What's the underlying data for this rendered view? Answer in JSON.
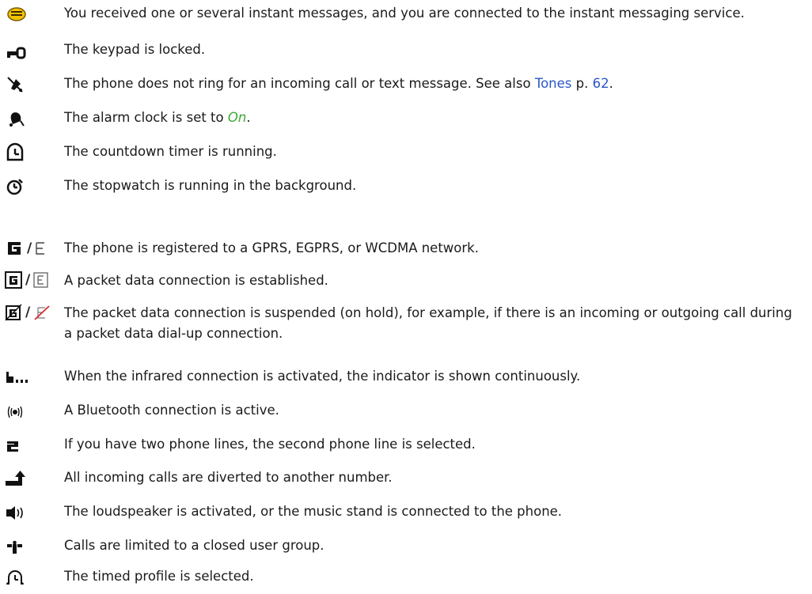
{
  "indicators": [
    {
      "icon": "instant-message-icon",
      "text": "You received one or several instant messages, and you are connected to the instant messaging service."
    },
    {
      "icon": "keypad-lock-icon",
      "text": "The keypad is locked."
    },
    {
      "icon": "silent-ringer-icon",
      "text_before": "The phone does not ring for an incoming call or text message. See also ",
      "link": "Tones",
      "text_mid": " p. ",
      "page": "62",
      "text_after": "."
    },
    {
      "icon": "alarm-clock-icon",
      "text_before": "The alarm clock is set to ",
      "emph": "On",
      "text_after": "."
    },
    {
      "icon": "countdown-timer-icon",
      "text": "The countdown timer is running."
    },
    {
      "icon": "stopwatch-icon",
      "text": "The stopwatch is running in the background."
    },
    {
      "icon": "gprs-egprs-registered-icon",
      "slash": "/",
      "text": "The phone is registered to a GPRS, EGPRS, or WCDMA network."
    },
    {
      "icon": "packet-data-active-icon",
      "slash": "/",
      "text": "A packet data connection is established."
    },
    {
      "icon": "packet-data-suspended-icon",
      "slash": "/",
      "text": "The packet data connection is suspended (on hold), for example, if there is an incoming or outgoing call during a packet data dial-up connection."
    },
    {
      "icon": "infrared-icon",
      "text": "When the infrared connection is activated, the indicator is shown continuously."
    },
    {
      "icon": "bluetooth-icon",
      "text": "A Bluetooth connection is active."
    },
    {
      "icon": "second-line-icon",
      "text": "If you have two phone lines, the second phone line is selected."
    },
    {
      "icon": "call-divert-icon",
      "text": "All incoming calls are diverted to another number."
    },
    {
      "icon": "loudspeaker-icon",
      "text": "The loudspeaker is activated, or the music stand is connected to the phone."
    },
    {
      "icon": "closed-user-group-icon",
      "text": "Calls are limited to a closed user group."
    },
    {
      "icon": "timed-profile-icon",
      "text": "The timed profile is selected."
    }
  ],
  "colors": {
    "link": "#2a56c6",
    "emphasis": "#3aa836",
    "message_icon": "#f2c200"
  }
}
